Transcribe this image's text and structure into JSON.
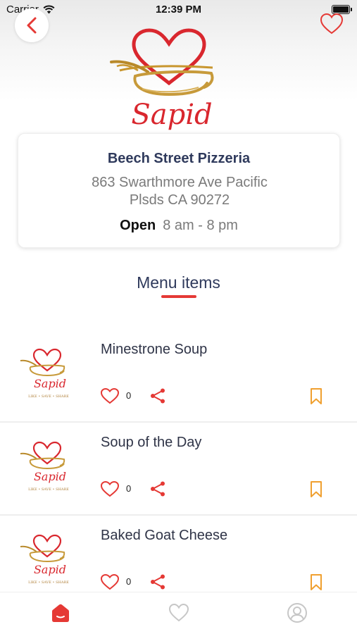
{
  "status_bar": {
    "carrier": "Carrier",
    "time": "12:39 PM"
  },
  "icons": {
    "back": "chevron-left-icon",
    "favorite": "heart-icon",
    "like": "heart-icon",
    "share": "share-icon",
    "save": "bookmark-icon",
    "tab_home": "home-icon",
    "tab_favorites": "heart-icon",
    "tab_profile": "user-icon"
  },
  "logo": {
    "text": "Sapid",
    "tagline": "LIKE • SAVE • SHARE"
  },
  "restaurant": {
    "name": "Beech Street Pizzeria",
    "address_line1": "863 Swarthmore Ave Pacific",
    "address_line2": "Plsds CA 90272",
    "status": "Open",
    "hours": "8 am - 8 pm"
  },
  "menu": {
    "title": "Menu items",
    "items": [
      {
        "name": "Minestrone Soup",
        "likes": "0"
      },
      {
        "name": "Soup of the Day",
        "likes": "0"
      },
      {
        "name": "Baked Goat Cheese",
        "likes": "0"
      }
    ]
  },
  "colors": {
    "accent": "#e53935",
    "save": "#f0a030",
    "title": "#2f3a5c",
    "tab_inactive": "#c7c7c7"
  }
}
